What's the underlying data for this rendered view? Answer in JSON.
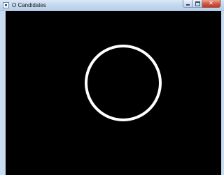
{
  "window": {
    "title": "O Candidates",
    "icon": "app-window-icon",
    "client_background": "#000000"
  },
  "detection": {
    "shape": "circle",
    "stroke_color": "#ffffff",
    "count": 1
  }
}
